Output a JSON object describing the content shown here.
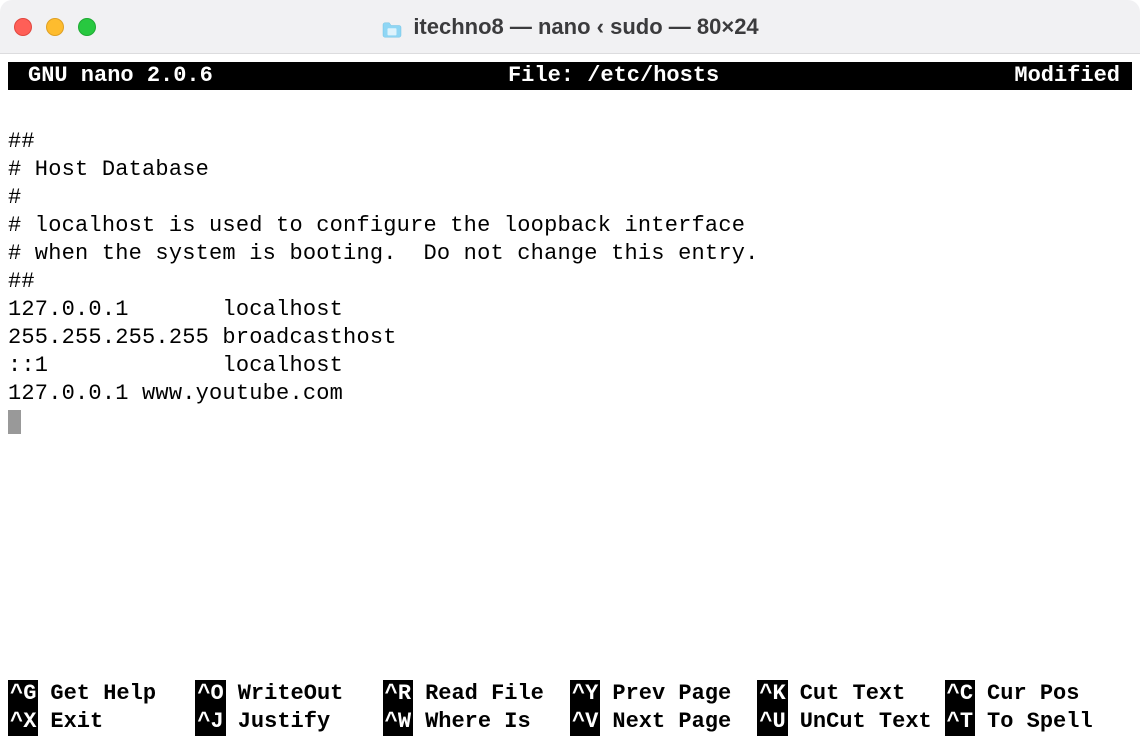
{
  "window": {
    "title": "itechno8 — nano ‹ sudo — 80×24"
  },
  "header": {
    "app": "GNU nano 2.0.6",
    "file_label": "File: /etc/hosts",
    "status": "Modified"
  },
  "file_lines": [
    "##",
    "# Host Database",
    "#",
    "# localhost is used to configure the loopback interface",
    "# when the system is booting.  Do not change this entry.",
    "##",
    "127.0.0.1       localhost",
    "255.255.255.255 broadcasthost",
    "::1             localhost",
    "127.0.0.1 www.youtube.com"
  ],
  "shortcuts_row1": [
    {
      "key": "^G",
      "label": "Get Help"
    },
    {
      "key": "^O",
      "label": "WriteOut"
    },
    {
      "key": "^R",
      "label": "Read File"
    },
    {
      "key": "^Y",
      "label": "Prev Page"
    },
    {
      "key": "^K",
      "label": "Cut Text"
    },
    {
      "key": "^C",
      "label": "Cur Pos"
    }
  ],
  "shortcuts_row2": [
    {
      "key": "^X",
      "label": "Exit"
    },
    {
      "key": "^J",
      "label": "Justify"
    },
    {
      "key": "^W",
      "label": "Where Is"
    },
    {
      "key": "^V",
      "label": "Next Page"
    },
    {
      "key": "^U",
      "label": "UnCut Text"
    },
    {
      "key": "^T",
      "label": "To Spell"
    }
  ]
}
